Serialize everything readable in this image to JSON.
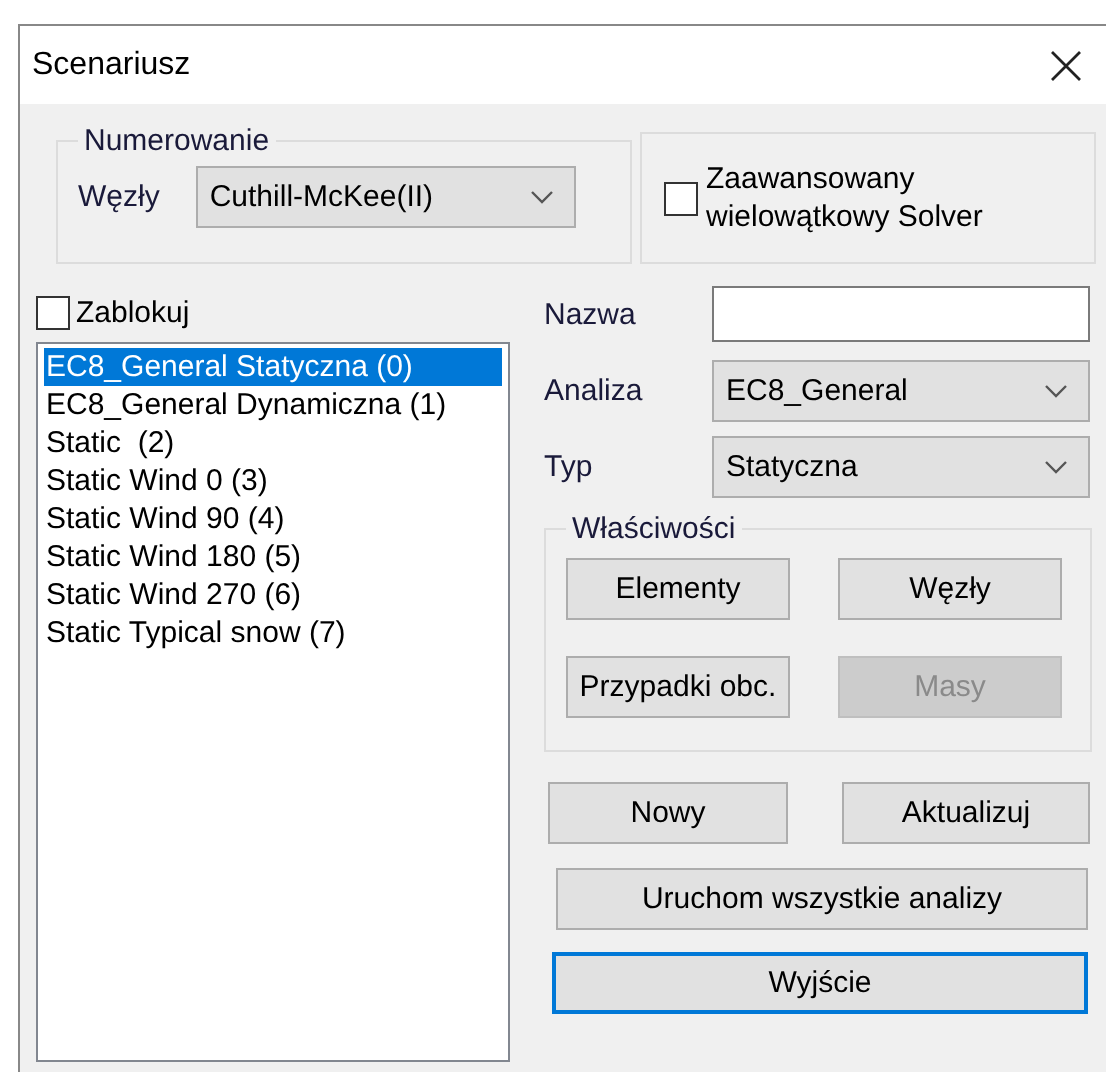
{
  "window": {
    "title": "Scenariusz"
  },
  "numbering": {
    "title": "Numerowanie",
    "label": "Węzły",
    "value": "Cuthill-McKee(II)"
  },
  "solver_option": {
    "label": "Zaawansowany wielowątkowy Solver",
    "checked": false
  },
  "lock": {
    "label": "Zablokuj",
    "checked": false
  },
  "scenarios": [
    {
      "label": "EC8_General Statyczna (0)",
      "selected": true
    },
    {
      "label": "EC8_General Dynamiczna (1)",
      "selected": false
    },
    {
      "label": "Static  (2)",
      "selected": false
    },
    {
      "label": "Static Wind 0 (3)",
      "selected": false
    },
    {
      "label": "Static Wind 90 (4)",
      "selected": false
    },
    {
      "label": "Static Wind 180 (5)",
      "selected": false
    },
    {
      "label": "Static Wind 270 (6)",
      "selected": false
    },
    {
      "label": "Static Typical snow (7)",
      "selected": false
    }
  ],
  "fields": [
    {
      "label": "Nazwa",
      "kind": "text"
    },
    {
      "label": "Analiza",
      "kind": "dropdown",
      "value": "EC8_General"
    },
    {
      "label": "Typ",
      "kind": "dropdown",
      "value": "Statyczna"
    }
  ],
  "properties": {
    "title": "Właściwości",
    "buttons": [
      {
        "label": "Elementy",
        "disabled": false
      },
      {
        "label": "Węzły",
        "disabled": false
      },
      {
        "label": "Przypadki obc.",
        "disabled": false
      },
      {
        "label": "Masy",
        "disabled": true
      }
    ]
  },
  "actions": [
    {
      "label": "Nowy",
      "kind": "half",
      "default": false
    },
    {
      "label": "Aktualizuj",
      "kind": "half",
      "default": false
    },
    {
      "label": "Uruchom wszystkie analizy",
      "kind": "wide",
      "default": false
    },
    {
      "label": "Wyjście",
      "kind": "wide",
      "default": true
    }
  ]
}
